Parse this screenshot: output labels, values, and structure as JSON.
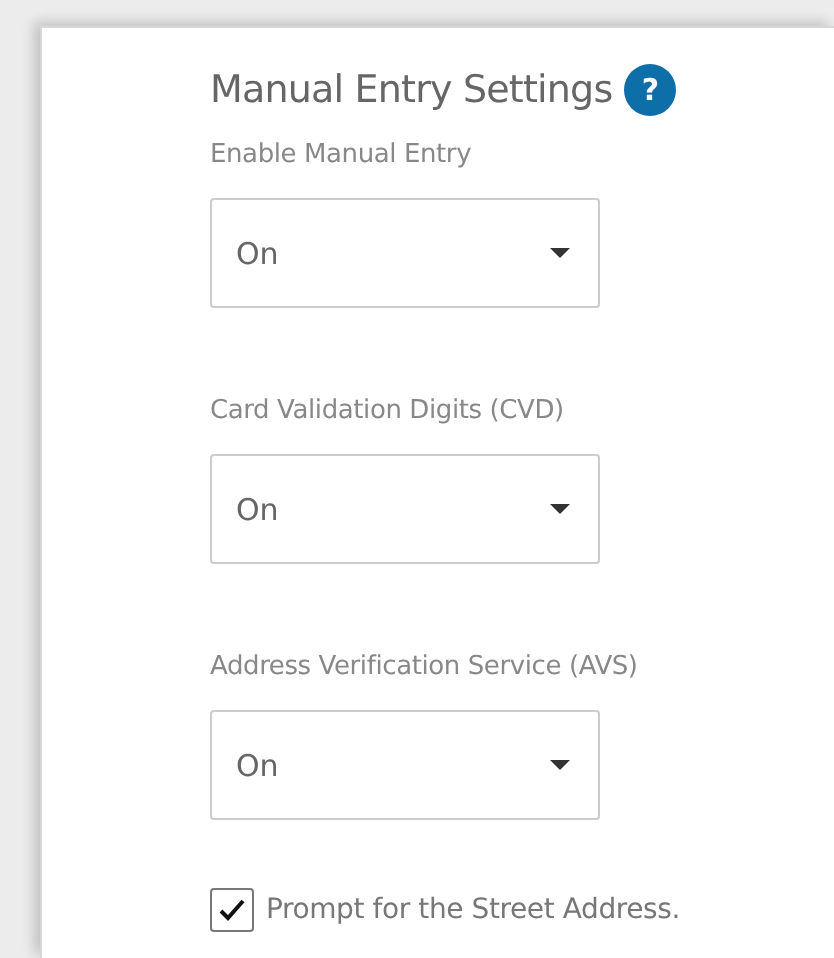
{
  "section": {
    "title": "Manual Entry Settings",
    "help": "?"
  },
  "fields": [
    {
      "label": "Enable Manual Entry",
      "value": "On"
    },
    {
      "label": "Card Validation Digits (CVD)",
      "value": "On"
    },
    {
      "label": "Address Verification Service (AVS)",
      "value": "On"
    }
  ],
  "options": [
    {
      "label": "Prompt for the Street Address.",
      "checked": true
    }
  ]
}
